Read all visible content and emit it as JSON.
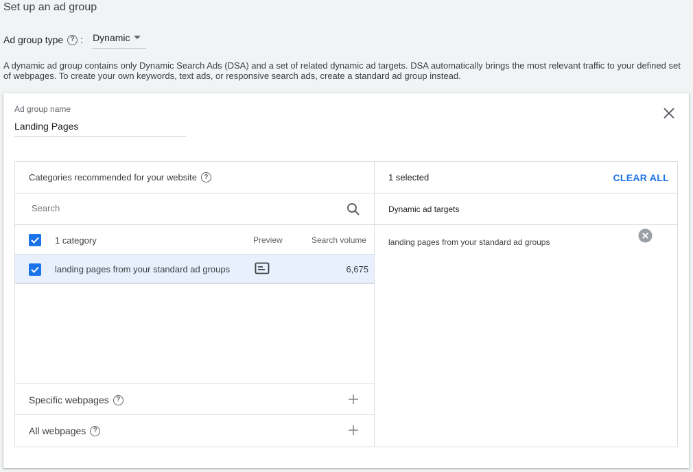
{
  "page": {
    "title": "Set up an ad group",
    "ad_group_type_label": "Ad group type",
    "ad_group_type_colon": ":",
    "ad_group_type_value": "Dynamic",
    "description": "A dynamic ad group contains only Dynamic Search Ads (DSA) and a set of related dynamic ad targets. DSA automatically brings the most relevant traffic to your defined set of webpages. To create your own keywords, text ads, or responsive search ads, create a standard ad group instead."
  },
  "card": {
    "name_label": "Ad group name",
    "name_value": "Landing Pages"
  },
  "left_panel": {
    "header": "Categories recommended for your website",
    "search_placeholder": "Search",
    "table_header": {
      "count": "1 category",
      "preview": "Preview",
      "search_volume": "Search volume"
    },
    "rows": [
      {
        "label": "landing pages from your standard ad groups",
        "volume": "6,675",
        "checked": true
      }
    ],
    "specific_webpages": "Specific webpages",
    "all_webpages": "All webpages"
  },
  "right_panel": {
    "selected_count": "1 selected",
    "clear_all": "CLEAR ALL",
    "subheader": "Dynamic ad targets",
    "targets": [
      {
        "label": "landing pages from your standard ad groups"
      }
    ]
  },
  "colors": {
    "accent": "#1a73e8",
    "selected_row": "#e8f0fe",
    "background": "#f1f3f4"
  },
  "icons": [
    "help-icon",
    "chevron-down-icon",
    "close-icon",
    "search-icon",
    "checkbox-icon",
    "preview-icon",
    "plus-icon",
    "remove-icon"
  ]
}
